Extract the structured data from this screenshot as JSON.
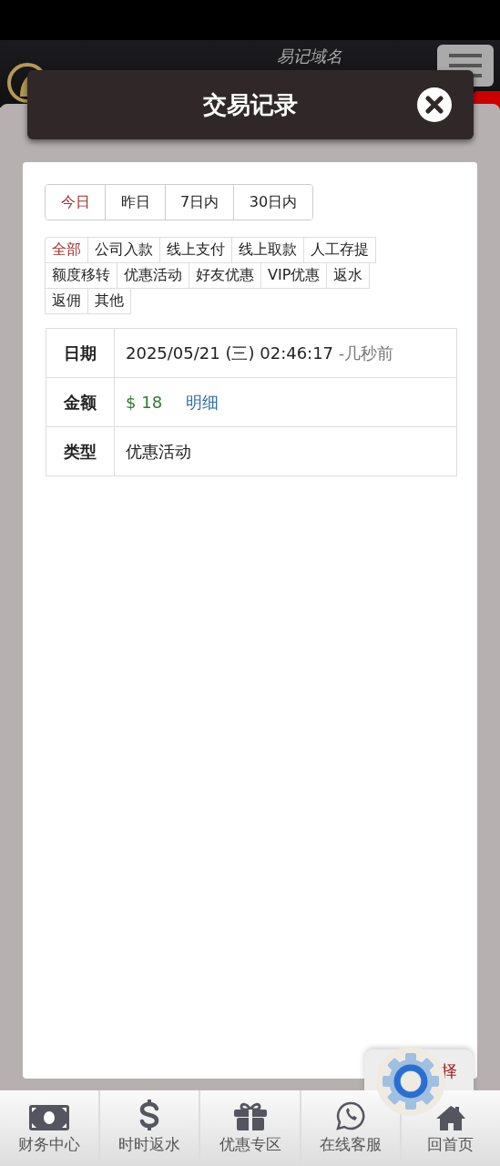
{
  "header": {
    "domain_label": "易记域名"
  },
  "dialog": {
    "title": "交易记录"
  },
  "date_tabs": [
    {
      "label": "今日",
      "selected": true
    },
    {
      "label": "昨日",
      "selected": false
    },
    {
      "label": "7日内",
      "selected": false
    },
    {
      "label": "30日内",
      "selected": false
    }
  ],
  "type_filters": [
    {
      "label": "全部",
      "selected": true
    },
    {
      "label": "公司入款",
      "selected": false
    },
    {
      "label": "线上支付",
      "selected": false
    },
    {
      "label": "线上取款",
      "selected": false
    },
    {
      "label": "人工存提",
      "selected": false
    },
    {
      "label": "额度移转",
      "selected": false
    },
    {
      "label": "优惠活动",
      "selected": false
    },
    {
      "label": "好友优惠",
      "selected": false
    },
    {
      "label": "VIP优惠",
      "selected": false
    },
    {
      "label": "返水",
      "selected": false
    },
    {
      "label": "返佣",
      "selected": false
    },
    {
      "label": "其他",
      "selected": false
    }
  ],
  "record": {
    "date_label": "日期",
    "date": "2025/05/21 (三) 02:46:17",
    "relative_time": "-几秒前",
    "amount_label": "金额",
    "amount": "$ 18",
    "detail_link": "明细",
    "type_label": "类型",
    "type": "优惠活动"
  },
  "floating_widget": {
    "label": "择"
  },
  "bottom_nav": [
    {
      "label": "财务中心",
      "kind": "money"
    },
    {
      "label": "时时返水",
      "kind": "dollar"
    },
    {
      "label": "优惠专区",
      "kind": "gift"
    },
    {
      "label": "在线客服",
      "kind": "chat"
    },
    {
      "label": "回首页",
      "kind": "home"
    }
  ]
}
